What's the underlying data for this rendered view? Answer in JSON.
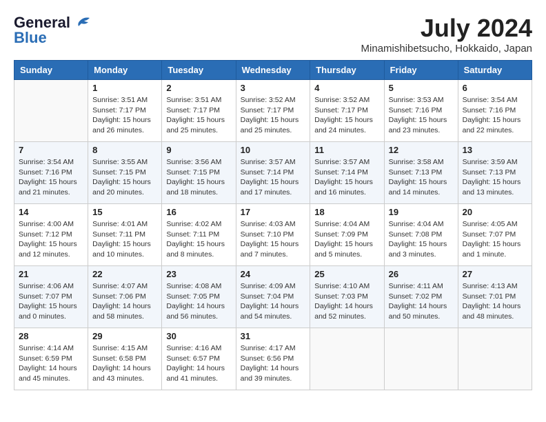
{
  "logo": {
    "line1": "General",
    "line2": "Blue"
  },
  "title": {
    "month_year": "July 2024",
    "location": "Minamishibetsucho, Hokkaido, Japan"
  },
  "headers": [
    "Sunday",
    "Monday",
    "Tuesday",
    "Wednesday",
    "Thursday",
    "Friday",
    "Saturday"
  ],
  "weeks": [
    [
      {
        "day": "",
        "sunrise": "",
        "sunset": "",
        "daylight": ""
      },
      {
        "day": "1",
        "sunrise": "Sunrise: 3:51 AM",
        "sunset": "Sunset: 7:17 PM",
        "daylight": "Daylight: 15 hours and 26 minutes."
      },
      {
        "day": "2",
        "sunrise": "Sunrise: 3:51 AM",
        "sunset": "Sunset: 7:17 PM",
        "daylight": "Daylight: 15 hours and 25 minutes."
      },
      {
        "day": "3",
        "sunrise": "Sunrise: 3:52 AM",
        "sunset": "Sunset: 7:17 PM",
        "daylight": "Daylight: 15 hours and 25 minutes."
      },
      {
        "day": "4",
        "sunrise": "Sunrise: 3:52 AM",
        "sunset": "Sunset: 7:17 PM",
        "daylight": "Daylight: 15 hours and 24 minutes."
      },
      {
        "day": "5",
        "sunrise": "Sunrise: 3:53 AM",
        "sunset": "Sunset: 7:16 PM",
        "daylight": "Daylight: 15 hours and 23 minutes."
      },
      {
        "day": "6",
        "sunrise": "Sunrise: 3:54 AM",
        "sunset": "Sunset: 7:16 PM",
        "daylight": "Daylight: 15 hours and 22 minutes."
      }
    ],
    [
      {
        "day": "7",
        "sunrise": "Sunrise: 3:54 AM",
        "sunset": "Sunset: 7:16 PM",
        "daylight": "Daylight: 15 hours and 21 minutes."
      },
      {
        "day": "8",
        "sunrise": "Sunrise: 3:55 AM",
        "sunset": "Sunset: 7:15 PM",
        "daylight": "Daylight: 15 hours and 20 minutes."
      },
      {
        "day": "9",
        "sunrise": "Sunrise: 3:56 AM",
        "sunset": "Sunset: 7:15 PM",
        "daylight": "Daylight: 15 hours and 18 minutes."
      },
      {
        "day": "10",
        "sunrise": "Sunrise: 3:57 AM",
        "sunset": "Sunset: 7:14 PM",
        "daylight": "Daylight: 15 hours and 17 minutes."
      },
      {
        "day": "11",
        "sunrise": "Sunrise: 3:57 AM",
        "sunset": "Sunset: 7:14 PM",
        "daylight": "Daylight: 15 hours and 16 minutes."
      },
      {
        "day": "12",
        "sunrise": "Sunrise: 3:58 AM",
        "sunset": "Sunset: 7:13 PM",
        "daylight": "Daylight: 15 hours and 14 minutes."
      },
      {
        "day": "13",
        "sunrise": "Sunrise: 3:59 AM",
        "sunset": "Sunset: 7:13 PM",
        "daylight": "Daylight: 15 hours and 13 minutes."
      }
    ],
    [
      {
        "day": "14",
        "sunrise": "Sunrise: 4:00 AM",
        "sunset": "Sunset: 7:12 PM",
        "daylight": "Daylight: 15 hours and 12 minutes."
      },
      {
        "day": "15",
        "sunrise": "Sunrise: 4:01 AM",
        "sunset": "Sunset: 7:11 PM",
        "daylight": "Daylight: 15 hours and 10 minutes."
      },
      {
        "day": "16",
        "sunrise": "Sunrise: 4:02 AM",
        "sunset": "Sunset: 7:11 PM",
        "daylight": "Daylight: 15 hours and 8 minutes."
      },
      {
        "day": "17",
        "sunrise": "Sunrise: 4:03 AM",
        "sunset": "Sunset: 7:10 PM",
        "daylight": "Daylight: 15 hours and 7 minutes."
      },
      {
        "day": "18",
        "sunrise": "Sunrise: 4:04 AM",
        "sunset": "Sunset: 7:09 PM",
        "daylight": "Daylight: 15 hours and 5 minutes."
      },
      {
        "day": "19",
        "sunrise": "Sunrise: 4:04 AM",
        "sunset": "Sunset: 7:08 PM",
        "daylight": "Daylight: 15 hours and 3 minutes."
      },
      {
        "day": "20",
        "sunrise": "Sunrise: 4:05 AM",
        "sunset": "Sunset: 7:07 PM",
        "daylight": "Daylight: 15 hours and 1 minute."
      }
    ],
    [
      {
        "day": "21",
        "sunrise": "Sunrise: 4:06 AM",
        "sunset": "Sunset: 7:07 PM",
        "daylight": "Daylight: 15 hours and 0 minutes."
      },
      {
        "day": "22",
        "sunrise": "Sunrise: 4:07 AM",
        "sunset": "Sunset: 7:06 PM",
        "daylight": "Daylight: 14 hours and 58 minutes."
      },
      {
        "day": "23",
        "sunrise": "Sunrise: 4:08 AM",
        "sunset": "Sunset: 7:05 PM",
        "daylight": "Daylight: 14 hours and 56 minutes."
      },
      {
        "day": "24",
        "sunrise": "Sunrise: 4:09 AM",
        "sunset": "Sunset: 7:04 PM",
        "daylight": "Daylight: 14 hours and 54 minutes."
      },
      {
        "day": "25",
        "sunrise": "Sunrise: 4:10 AM",
        "sunset": "Sunset: 7:03 PM",
        "daylight": "Daylight: 14 hours and 52 minutes."
      },
      {
        "day": "26",
        "sunrise": "Sunrise: 4:11 AM",
        "sunset": "Sunset: 7:02 PM",
        "daylight": "Daylight: 14 hours and 50 minutes."
      },
      {
        "day": "27",
        "sunrise": "Sunrise: 4:13 AM",
        "sunset": "Sunset: 7:01 PM",
        "daylight": "Daylight: 14 hours and 48 minutes."
      }
    ],
    [
      {
        "day": "28",
        "sunrise": "Sunrise: 4:14 AM",
        "sunset": "Sunset: 6:59 PM",
        "daylight": "Daylight: 14 hours and 45 minutes."
      },
      {
        "day": "29",
        "sunrise": "Sunrise: 4:15 AM",
        "sunset": "Sunset: 6:58 PM",
        "daylight": "Daylight: 14 hours and 43 minutes."
      },
      {
        "day": "30",
        "sunrise": "Sunrise: 4:16 AM",
        "sunset": "Sunset: 6:57 PM",
        "daylight": "Daylight: 14 hours and 41 minutes."
      },
      {
        "day": "31",
        "sunrise": "Sunrise: 4:17 AM",
        "sunset": "Sunset: 6:56 PM",
        "daylight": "Daylight: 14 hours and 39 minutes."
      },
      {
        "day": "",
        "sunrise": "",
        "sunset": "",
        "daylight": ""
      },
      {
        "day": "",
        "sunrise": "",
        "sunset": "",
        "daylight": ""
      },
      {
        "day": "",
        "sunrise": "",
        "sunset": "",
        "daylight": ""
      }
    ]
  ]
}
